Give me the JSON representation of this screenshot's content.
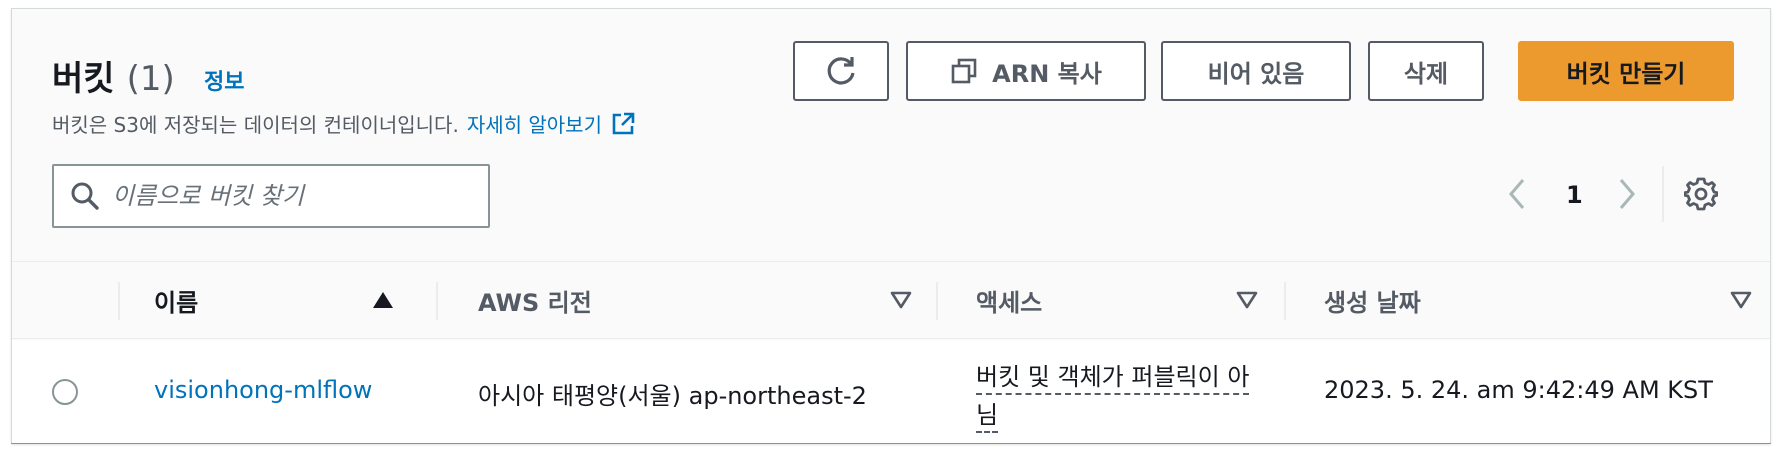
{
  "header": {
    "title": "버킷",
    "count": "(1)",
    "info_link": "정보",
    "description": "버킷은 S3에 저장되는 데이터의 컨테이너입니다.",
    "learn_more": "자세히 알아보기"
  },
  "toolbar": {
    "refresh_icon": "refresh-icon",
    "copy_arn_label": "ARN 복사",
    "empty_label": "비어 있음",
    "delete_label": "삭제",
    "create_label": "버킷 만들기"
  },
  "search": {
    "placeholder": "이름으로 버킷 찾기",
    "value": ""
  },
  "pagination": {
    "current_page": "1"
  },
  "table": {
    "columns": [
      {
        "label": "이름",
        "sort": "ascending"
      },
      {
        "label": "AWS 리전",
        "sort": "none"
      },
      {
        "label": "액세스",
        "sort": "none"
      },
      {
        "label": "생성 날짜",
        "sort": "none"
      }
    ],
    "rows": [
      {
        "name": "visionhong-mlflow",
        "region": "아시아 태평양(서울) ap-northeast-2",
        "access": "버킷 및 객체가 퍼블릭이 아님",
        "created": "2023. 5. 24. am 9:42:49 AM KST"
      }
    ]
  },
  "colors": {
    "link": "#0073bb",
    "primary_button": "#ec9a2e",
    "text": "#16191f",
    "muted_text": "#545b64"
  }
}
